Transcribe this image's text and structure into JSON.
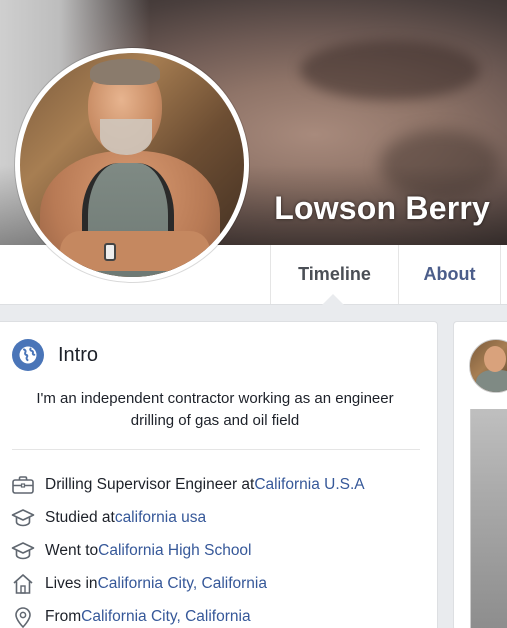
{
  "profile": {
    "name": "Lowson Berry"
  },
  "tabs": [
    {
      "label": "Timeline",
      "active": true
    },
    {
      "label": "About",
      "active": false
    }
  ],
  "intro": {
    "title": "Intro",
    "bio": "I'm an independent contractor working as an engineer drilling of gas and oil field",
    "items": [
      {
        "icon": "briefcase-icon",
        "prefix": "Drilling Supervisor Engineer at ",
        "link": "California U.S.A"
      },
      {
        "icon": "graduation-cap-icon",
        "prefix": "Studied at ",
        "link": "california usa"
      },
      {
        "icon": "graduation-cap-icon",
        "prefix": "Went to ",
        "link": "California High School"
      },
      {
        "icon": "home-icon",
        "prefix": "Lives in ",
        "link": "California City, California"
      },
      {
        "icon": "location-pin-icon",
        "prefix": "From ",
        "link": "California City, California"
      }
    ]
  },
  "colors": {
    "link": "#365899",
    "accent": "#4a75b8",
    "page_bg": "#e9ebee"
  }
}
